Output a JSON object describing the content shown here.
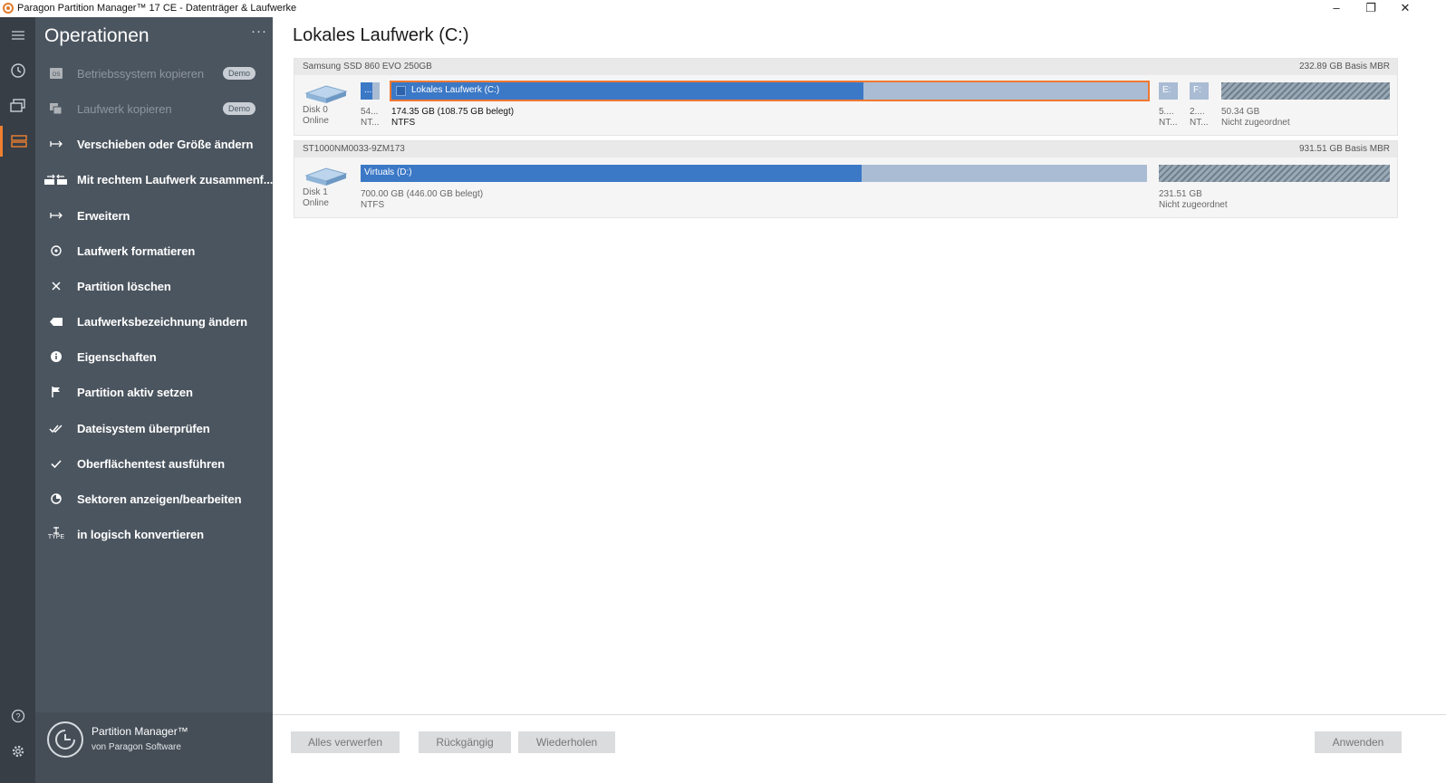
{
  "window": {
    "title": "Paragon Partition Manager™ 17 CE - Datenträger & Laufwerke",
    "minimize": "–",
    "restore": "❐",
    "close": "✕"
  },
  "colors": {
    "accent": "#f07830",
    "rail_bg": "#373e46",
    "panel_bg": "#4b555f",
    "used": "#3b78c6",
    "free": "#a9bcd4"
  },
  "operations": {
    "title": "Operationen",
    "more": "···",
    "items": [
      {
        "label": "Betriebssystem kopieren",
        "badge": "Demo",
        "icon": "os-copy-icon"
      },
      {
        "label": "Laufwerk kopieren",
        "badge": "Demo",
        "icon": "copy-icon"
      },
      {
        "label": "Verschieben oder Größe ändern",
        "icon": "resize-icon"
      },
      {
        "label": "Mit rechtem Laufwerk zusammenf...",
        "icon": "merge-icon"
      },
      {
        "label": "Erweitern",
        "icon": "expand-icon"
      },
      {
        "label": "Laufwerk formatieren",
        "icon": "format-icon"
      },
      {
        "label": "Partition löschen",
        "icon": "delete-icon"
      },
      {
        "label": "Laufwerksbezeichnung ändern",
        "icon": "label-icon"
      },
      {
        "label": "Eigenschaften",
        "icon": "info-icon"
      },
      {
        "label": "Partition aktiv setzen",
        "icon": "flag-icon"
      },
      {
        "label": "Dateisystem überprüfen",
        "icon": "double-check-icon"
      },
      {
        "label": "Oberflächentest ausführen",
        "icon": "check-icon"
      },
      {
        "label": "Sektoren anzeigen/bearbeiten",
        "icon": "sector-icon"
      },
      {
        "label": "in logisch konvertieren",
        "icon": "type-icon",
        "icon_text": "TYPE"
      }
    ]
  },
  "brand": {
    "name": "Partition Manager™",
    "sub": "von Paragon Software"
  },
  "main": {
    "title": "Lokales Laufwerk (C:)"
  },
  "disks": [
    {
      "model": "Samsung SSD 860 EVO 250GB",
      "size": "232.89 GB Basis MBR",
      "number": "Disk 0",
      "status": "Online",
      "partitions": [
        {
          "name": "...",
          "info1": "54...",
          "info2": "NT...",
          "used_fraction": 0.6
        },
        {
          "name": "Lokales Laufwerk (C:)",
          "info1": "174.35 GB (108.75 GB belegt)",
          "info2": "NTFS",
          "used_fraction": 0.624,
          "selected": true
        },
        {
          "name": "E:",
          "info1": "5....",
          "info2": "NT..."
        },
        {
          "name": "F:",
          "info1": "2....",
          "info2": "NT..."
        },
        {
          "name": "",
          "info1": "50.34 GB",
          "info2": "Nicht zugeordnet",
          "unallocated": true
        }
      ]
    },
    {
      "model": "ST1000NM0033-9ZM173",
      "size": "931.51 GB Basis MBR",
      "number": "Disk 1",
      "status": "Online",
      "partitions": [
        {
          "name": "Virtuals (D:)",
          "info1": "700.00 GB (446.00 GB belegt)",
          "info2": "NTFS",
          "used_fraction": 0.637
        },
        {
          "name": "",
          "info1": "231.51 GB",
          "info2": "Nicht zugeordnet",
          "unallocated": true
        }
      ]
    }
  ],
  "footer": {
    "discard_all": "Alles verwerfen",
    "undo": "Rückgängig",
    "redo": "Wiederholen",
    "apply": "Anwenden"
  }
}
